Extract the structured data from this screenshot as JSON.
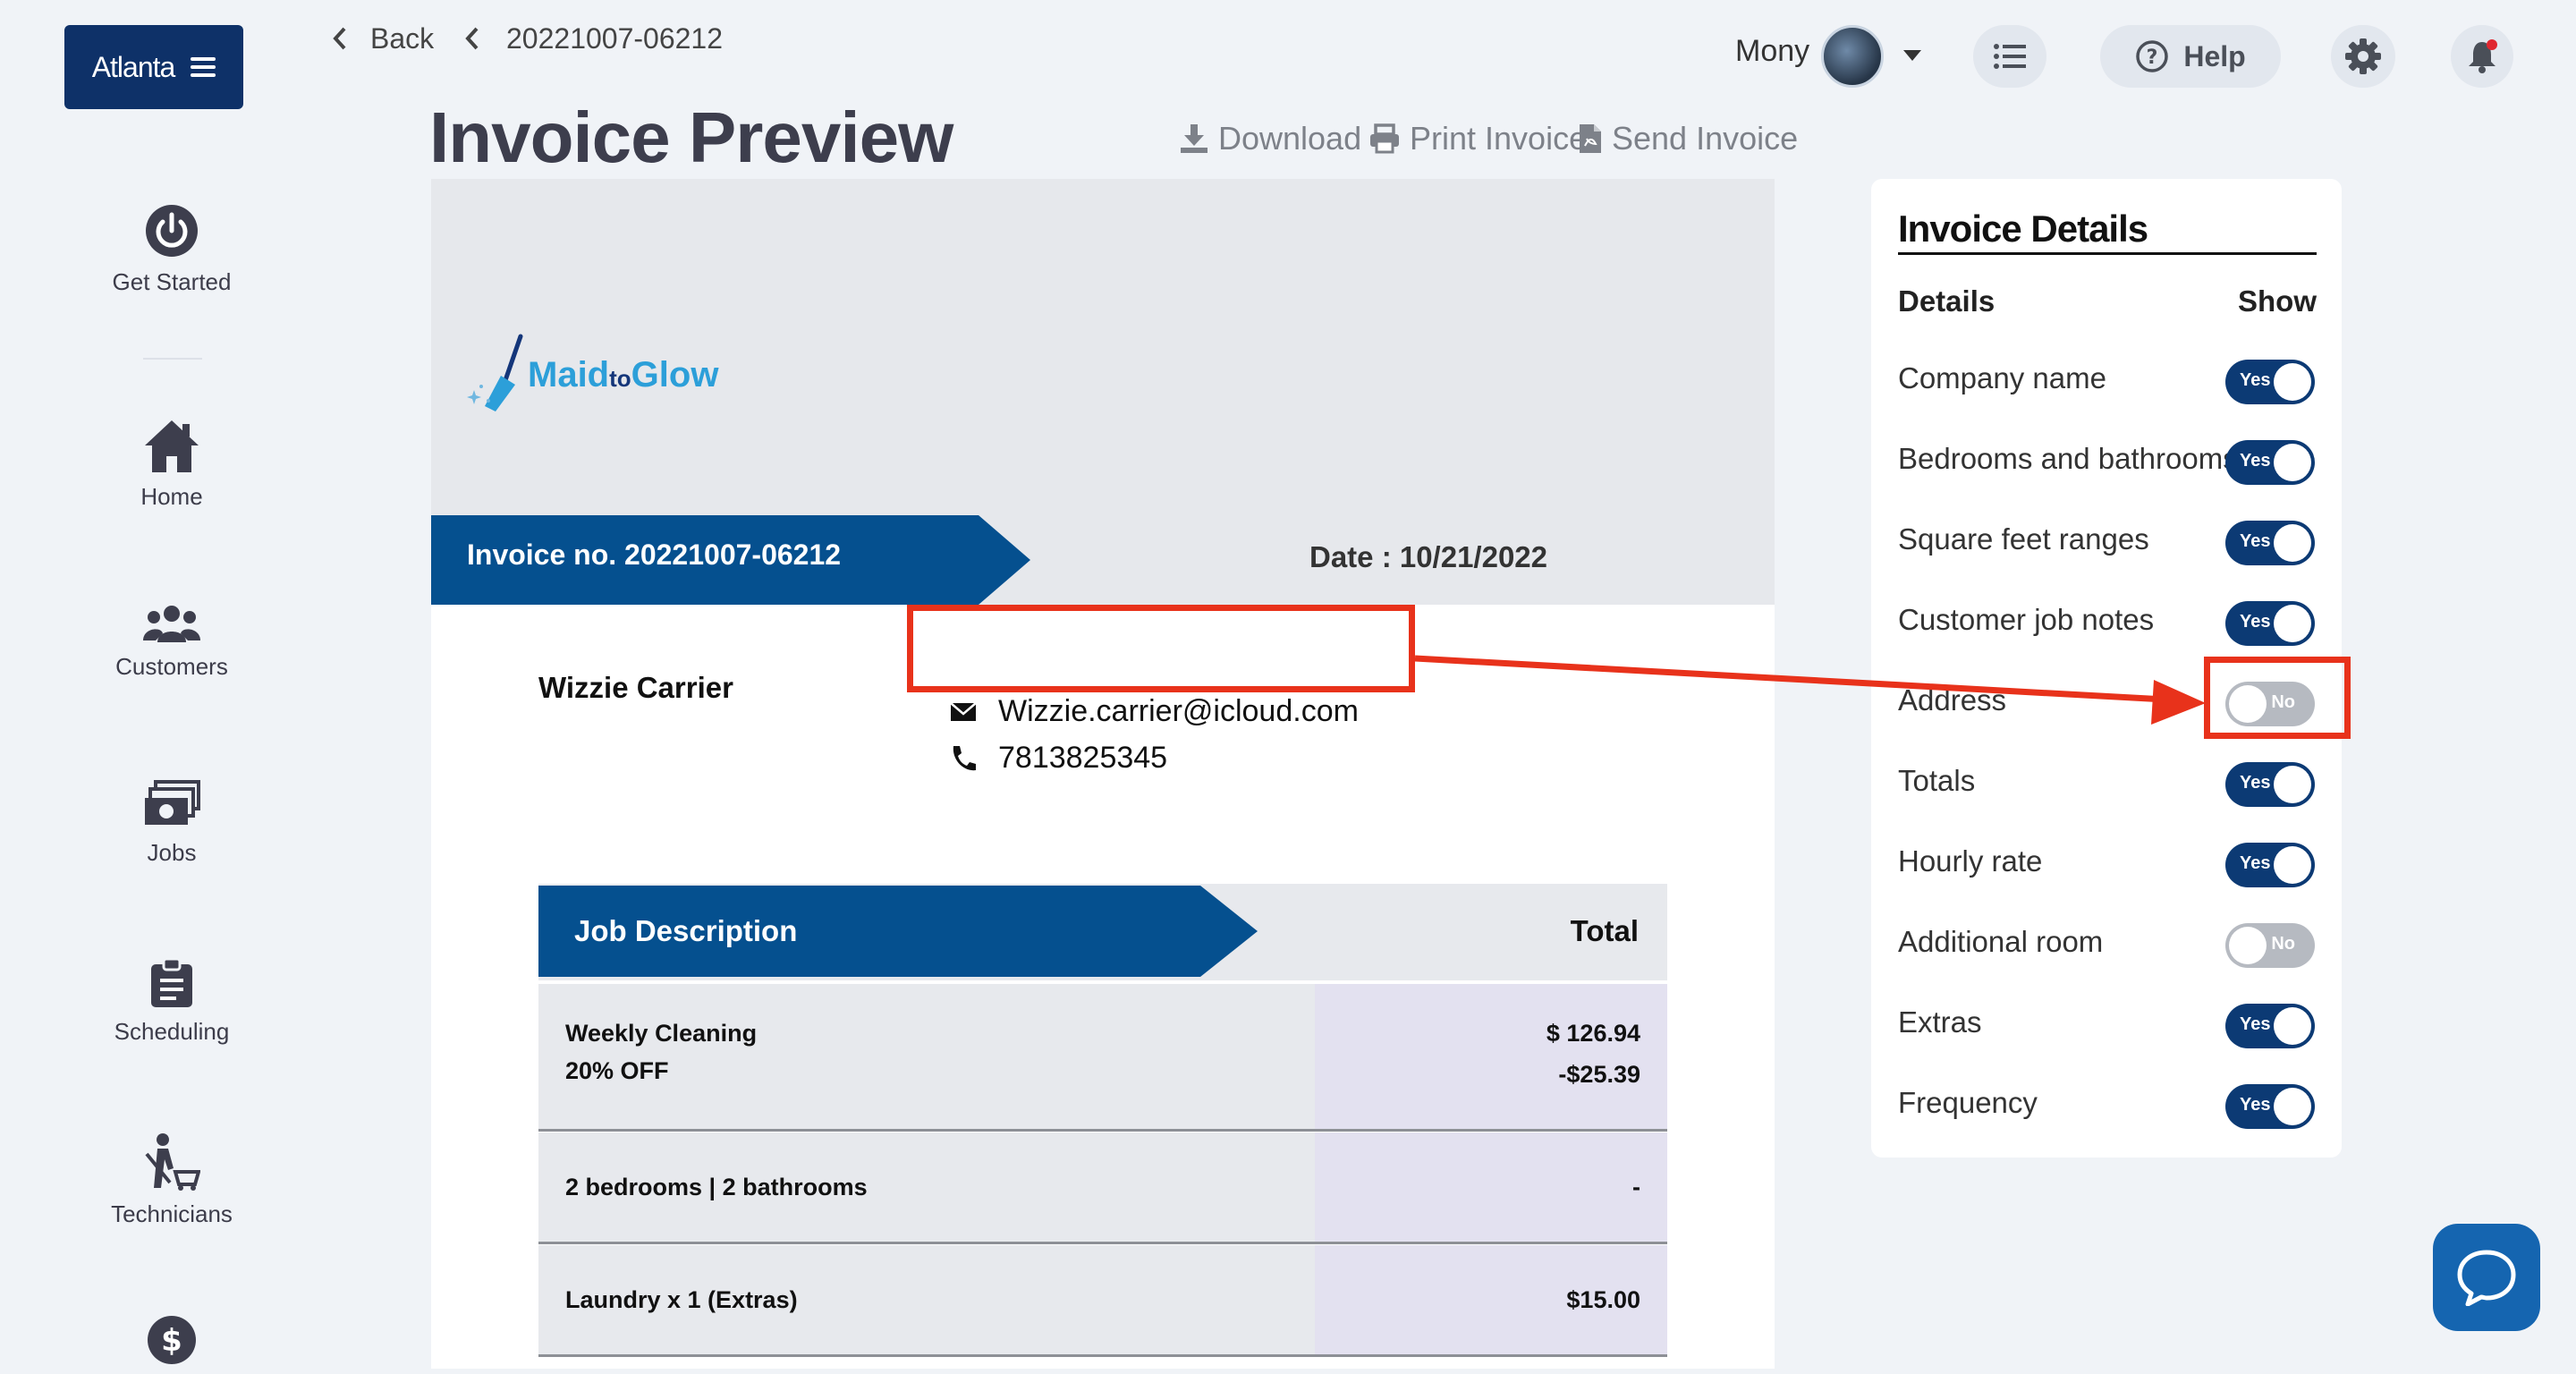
{
  "sidebar": {
    "brand": "Atlanta",
    "items": [
      {
        "label": "Get Started",
        "icon": "power-icon"
      },
      {
        "label": "Home",
        "icon": "home-icon"
      },
      {
        "label": "Customers",
        "icon": "users-icon"
      },
      {
        "label": "Jobs",
        "icon": "money-stack-icon"
      },
      {
        "label": "Scheduling",
        "icon": "clipboard-icon"
      },
      {
        "label": "Technicians",
        "icon": "cleaner-icon"
      },
      {
        "label": "",
        "icon": "dollar-icon"
      }
    ]
  },
  "topbar": {
    "back": "Back",
    "breadcrumb": "20221007-06212",
    "user": "Mony",
    "help": "Help"
  },
  "page": {
    "title": "Invoice Preview",
    "actions": {
      "download": "Download",
      "print": "Print Invoice",
      "send": "Send Invoice"
    }
  },
  "invoice": {
    "logo": {
      "part1": "Maid",
      "part2": "to",
      "part3": "Glow"
    },
    "number": "Invoice no. 20221007-06212",
    "date": "Date : 10/21/2022",
    "customer": "Wizzie Carrier",
    "email": "Wizzie.carrier@icloud.com",
    "phone": "7813825345",
    "table": {
      "headers": {
        "desc": "Job Description",
        "total": "Total"
      },
      "rows": [
        {
          "desc1": "Weekly Cleaning",
          "desc2": "20% OFF",
          "amt1": "$ 126.94",
          "amt2": "-$25.39"
        },
        {
          "desc1": "2 bedrooms | 2 bathrooms",
          "amt1": "-"
        },
        {
          "desc1": "Laundry x 1 (Extras)",
          "amt1": "$15.00"
        }
      ]
    }
  },
  "details": {
    "title": "Invoice Details",
    "col_details": "Details",
    "col_show": "Show",
    "options": [
      {
        "label": "Company name",
        "on": true,
        "state": "Yes"
      },
      {
        "label": "Bedrooms and bathrooms",
        "on": true,
        "state": "Yes"
      },
      {
        "label": "Square feet ranges",
        "on": true,
        "state": "Yes"
      },
      {
        "label": "Customer job notes",
        "on": true,
        "state": "Yes"
      },
      {
        "label": "Address",
        "on": false,
        "state": "No"
      },
      {
        "label": "Totals",
        "on": true,
        "state": "Yes"
      },
      {
        "label": "Hourly rate",
        "on": true,
        "state": "Yes"
      },
      {
        "label": "Additional room",
        "on": false,
        "state": "No"
      },
      {
        "label": "Extras",
        "on": true,
        "state": "Yes"
      },
      {
        "label": "Frequency",
        "on": true,
        "state": "Yes"
      }
    ]
  },
  "colors": {
    "brand": "#0e3168",
    "banner": "#05508f",
    "annotation": "#e8321b",
    "toggle_on": "#0c3a74"
  }
}
